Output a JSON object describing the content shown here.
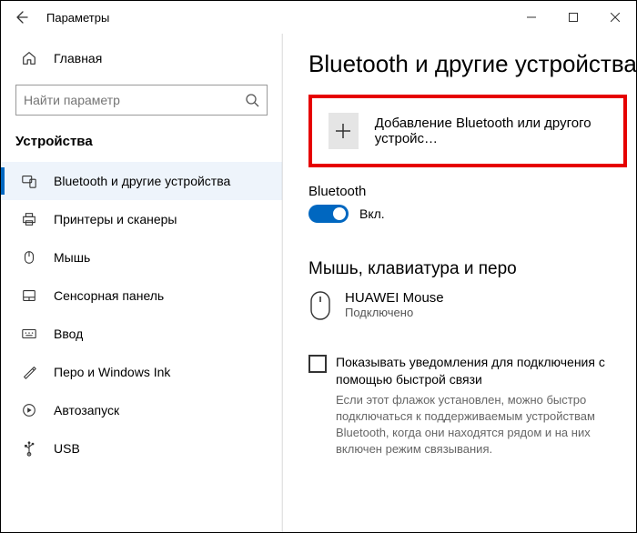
{
  "titlebar": {
    "title": "Параметры"
  },
  "sidebar": {
    "home": "Главная",
    "search_placeholder": "Найти параметр",
    "category": "Устройства",
    "items": [
      {
        "label": "Bluetooth и другие устройства"
      },
      {
        "label": "Принтеры и сканеры"
      },
      {
        "label": "Мышь"
      },
      {
        "label": "Сенсорная панель"
      },
      {
        "label": "Ввод"
      },
      {
        "label": "Перо и Windows Ink"
      },
      {
        "label": "Автозапуск"
      },
      {
        "label": "USB"
      }
    ]
  },
  "content": {
    "page_title": "Bluetooth и другие устройства",
    "add_device_label": "Добавление Bluetooth или другого устройс…",
    "bluetooth_label": "Bluetooth",
    "toggle_state": "Вкл.",
    "devices_heading": "Мышь, клавиатура и перо",
    "device": {
      "name": "HUAWEI  Mouse",
      "status": "Подключено"
    },
    "notify": {
      "label": "Показывать уведомления для подключения с помощью быстрой связи",
      "desc": "Если этот флажок установлен, можно быстро подключаться к поддерживаемым устройствам Bluetooth, когда они находятся рядом и на них включен режим связывания."
    }
  }
}
